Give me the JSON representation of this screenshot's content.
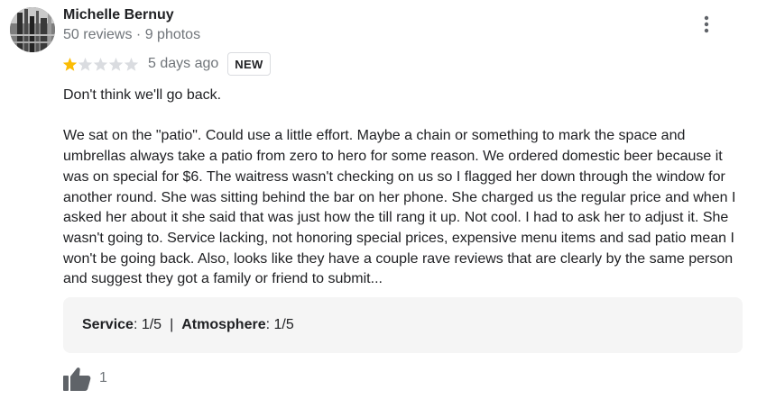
{
  "reviewer": {
    "name": "Michelle Bernuy",
    "meta": "50 reviews · 9 photos"
  },
  "review": {
    "rating": 1,
    "rating_max": 5,
    "date": "5 days ago",
    "badge": "NEW",
    "paragraph_1": "Don't think we'll go back.",
    "paragraph_2": "We sat on the \"patio\". Could use a little effort. Maybe a chain or something to mark the space and umbrellas always take a patio from zero to hero for some reason. We ordered domestic beer because it was on special for $6. The waitress wasn't checking on us so I flagged her down through the window for another round. She was sitting behind the bar on her phone. She charged us the regular price and when I asked her about it she said that was just how the till rang it up. Not cool. I had to ask her to adjust it. She wasn't going to. Service lacking, not honoring special prices, expensive menu items and sad patio mean I won't be going back. Also, looks like they have a couple rave reviews that are clearly by the same person and suggest they got a family or friend to submit..."
  },
  "attributes": {
    "service_label": "Service",
    "service_value": ": 1/5",
    "separator": "|",
    "atmosphere_label": "Atmosphere",
    "atmosphere_value": ": 1/5"
  },
  "actions": {
    "like_count": "1",
    "more_icon": "more-vert-icon",
    "like_icon": "thumbs-up-icon"
  },
  "colors": {
    "star_filled": "#fbbc04",
    "star_empty": "#dadce0",
    "secondary_text": "#70757a",
    "attributes_bg": "#f5f5f5"
  }
}
